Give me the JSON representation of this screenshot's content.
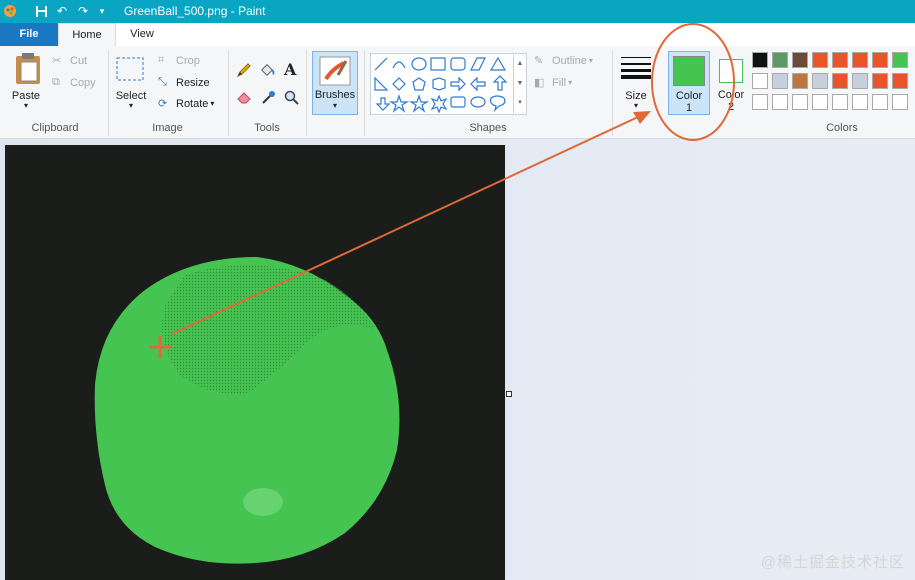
{
  "window": {
    "title": "GreenBall_500.png - Paint"
  },
  "tabs": {
    "file": "File",
    "home": "Home",
    "view": "View"
  },
  "clipboard": {
    "paste": "Paste",
    "cut": "Cut",
    "copy": "Copy",
    "group": "Clipboard"
  },
  "image": {
    "select": "Select",
    "crop": "Crop",
    "resize": "Resize",
    "rotate": "Rotate",
    "group": "Image"
  },
  "tools": {
    "group": "Tools"
  },
  "brushes": {
    "label": "Brushes"
  },
  "shapes": {
    "outline": "Outline",
    "fill": "Fill",
    "group": "Shapes"
  },
  "size": {
    "label": "Size"
  },
  "color1": {
    "label": "Color",
    "num": "1",
    "value": "#46c452"
  },
  "color2": {
    "label": "Color",
    "num": "2"
  },
  "colors": {
    "group": "Colors",
    "palette_row1": [
      "#0f1411",
      "#5a9a63",
      "#6b4a38",
      "#e8552a",
      "#e8552a",
      "#e8552a",
      "#e8552a",
      "#46c452"
    ],
    "palette_row2": [
      "#ffffff",
      "#c8cfdc",
      "#c0763a",
      "#c8cfdc",
      "#e8552a",
      "#c8cfdc",
      "#e8552a",
      "#e8552a"
    ],
    "palette_row3": [
      "#ffffff",
      "#ffffff",
      "#ffffff",
      "#ffffff",
      "#ffffff",
      "#ffffff",
      "#ffffff",
      "#ffffff"
    ]
  },
  "canvas": {
    "ball_color": "#46c452",
    "background": "#1b1d1b"
  },
  "annotation": {
    "color": "#e0693a"
  },
  "watermark": "@稀土掘金技术社区"
}
